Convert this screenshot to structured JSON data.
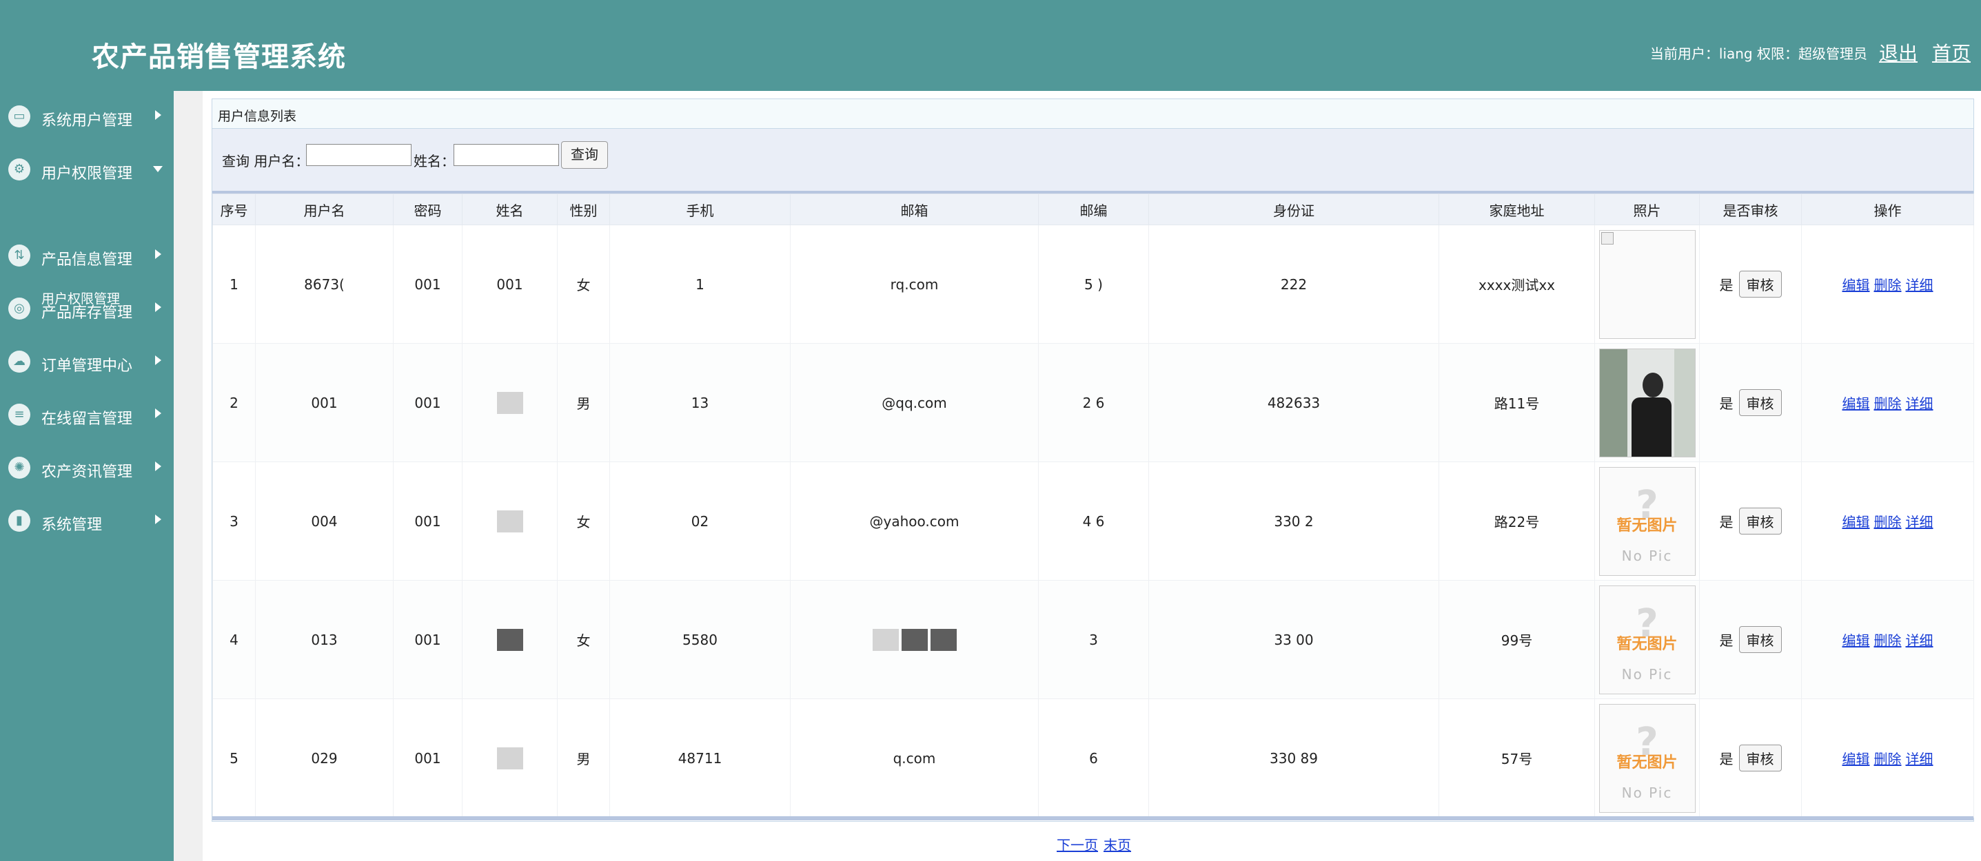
{
  "header": {
    "app_title": "农产品销售管理系统",
    "user_info": "当前用户：liang  权限：超级管理员",
    "logout_label": "退出",
    "home_label": "首页",
    "background": "#519898"
  },
  "sidebar": {
    "items": [
      {
        "label": "系统用户管理",
        "icon": "monitor-icon"
      },
      {
        "label": "用户权限管理",
        "icon": "user-gear-icon",
        "expanded": true
      },
      {
        "label": "产品信息管理",
        "icon": "arrows-icon"
      },
      {
        "label": "产品库存管理",
        "icon": "app-icon"
      },
      {
        "label": "订单管理中心",
        "icon": "cloud-icon"
      },
      {
        "label": "在线留言管理",
        "icon": "stack-icon"
      },
      {
        "label": "农产资讯管理",
        "icon": "wheel-icon"
      },
      {
        "label": "系统管理",
        "icon": "bar-chart-icon"
      }
    ],
    "subitem": "用户权限管理"
  },
  "panel": {
    "title": "用户信息列表",
    "search": {
      "query_label": "查询 用户名：",
      "username_value": "",
      "name_label": "姓名：",
      "name_value": "",
      "button_label": "查询"
    }
  },
  "table": {
    "columns": [
      "序号",
      "用户名",
      "密码",
      "姓名",
      "性别",
      "手机",
      "邮箱",
      "邮编",
      "身份证",
      "家庭地址",
      "照片",
      "是否审核",
      "操作"
    ],
    "rows": [
      {
        "no": "1",
        "username": "8673(",
        "password": "001",
        "name": "001",
        "gender": "女",
        "phone": "1",
        "email": "rq.com",
        "zip": "5    )",
        "idcard": "222",
        "address": "xxxx测试xx",
        "photo": "broken",
        "audited": "是",
        "audit_btn": "审核"
      },
      {
        "no": "2",
        "username": "001",
        "password": "001",
        "name": "",
        "gender": "男",
        "phone": "13",
        "email": "@qq.com",
        "zip": "2    6",
        "idcard": "482633",
        "address": "路11号",
        "photo": "person",
        "audited": "是",
        "audit_btn": "审核"
      },
      {
        "no": "3",
        "username": "004",
        "password": "001",
        "name": "",
        "gender": "女",
        "phone": "02",
        "email": "@yahoo.com",
        "zip": "4    6",
        "idcard": "330          2",
        "address": "路22号",
        "photo": "nopic",
        "audited": "是",
        "audit_btn": "审核"
      },
      {
        "no": "4",
        "username": "013",
        "password": "001",
        "name": "",
        "gender": "女",
        "phone": "5580",
        "email": "",
        "zip": "3",
        "idcard": "33      00",
        "address": "99号",
        "photo": "nopic",
        "audited": "是",
        "audit_btn": "审核"
      },
      {
        "no": "5",
        "username": "029",
        "password": "001",
        "name": "",
        "gender": "男",
        "phone": "48711",
        "email": "q.com",
        "zip": "6",
        "idcard": "330     89",
        "address": "57号",
        "photo": "nopic",
        "audited": "是",
        "audit_btn": "审核"
      }
    ],
    "ops": {
      "edit": "编辑",
      "delete": "删除",
      "detail": "详细"
    },
    "nopic": {
      "cn": "暂无图片",
      "en": "No Pic",
      "mark": "?"
    }
  },
  "pager": {
    "next": "下一页",
    "last": "末页"
  }
}
